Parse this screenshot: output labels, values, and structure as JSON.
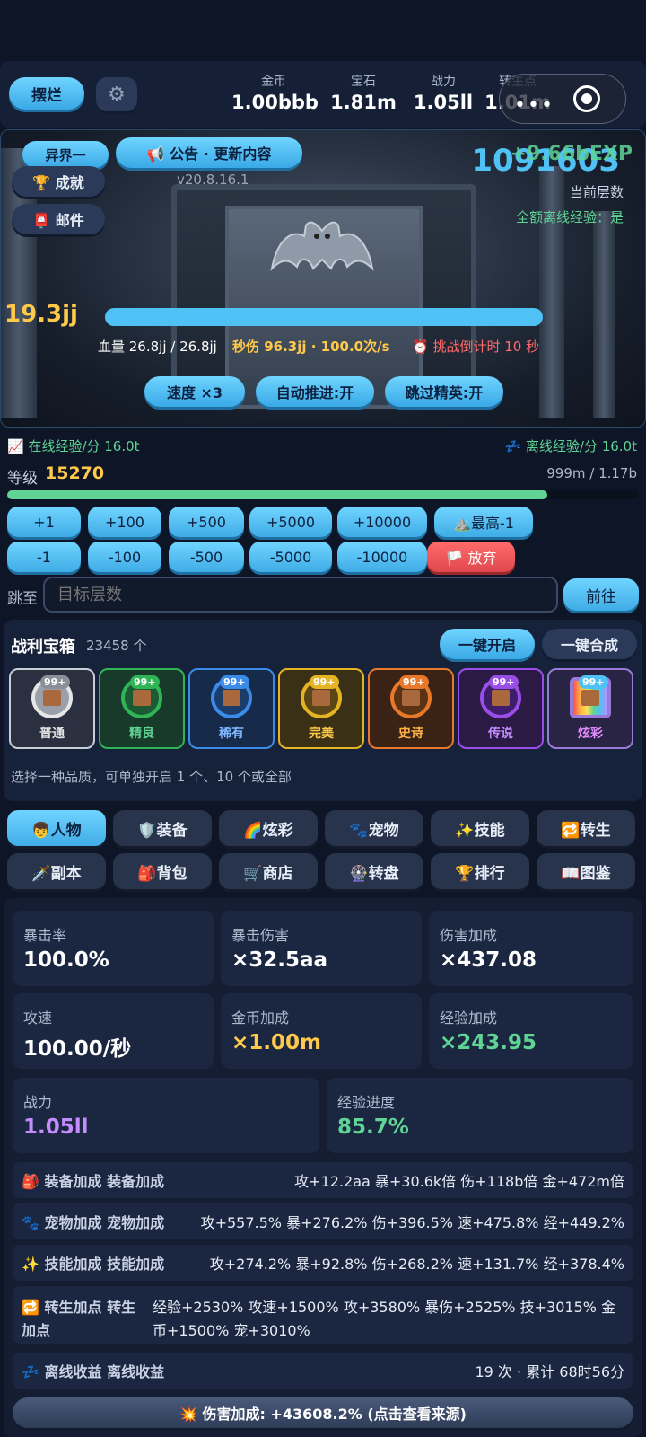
{
  "topbar": {
    "layout_btn": "摆烂",
    "settings_icon": "gear-icon",
    "stats": [
      {
        "label": "金币",
        "value": "1.00bbb"
      },
      {
        "label": "宝石",
        "value": "1.81m"
      },
      {
        "label": "战力",
        "value": "1.05ll"
      },
      {
        "label": "转生点",
        "value": "1.01m"
      }
    ]
  },
  "hero": {
    "world_btn": "异界一",
    "notice_btn": "📢 公告 · 更新内容",
    "achievement_btn": "🏆 成就",
    "mail_btn": "📮 邮件",
    "version": "v20.8.16.1",
    "floor_value": "1091603",
    "floor_overlay": "+9.66bEXP",
    "floor_label": "当前层数",
    "offline_full": "全额离线经验：是",
    "enemy_dmg": "19.3jj",
    "hp_text": "血量 26.8jj / 26.8jj",
    "dps_text": "秒伤 96.3jj · 100.0次/s",
    "countdown": "⏰ 挑战倒计时 10 秒",
    "hp_fraction": 1.0,
    "speed_btn": "速度 ×3",
    "auto_btn": "自动推进:开",
    "skip_btn": "跳过精英:开"
  },
  "exp": {
    "online": "📈 在线经验/分 16.0t",
    "offline": "💤 离线经验/分 16.0t",
    "level_label": "等级",
    "level": "15270",
    "progress_text": "999m / 1.17b",
    "progress_fraction": 0.855
  },
  "steps": {
    "plus": [
      "+1",
      "+100",
      "+500",
      "+5000",
      "+10000"
    ],
    "max": "⛰️最高-1",
    "minus": [
      "-1",
      "-100",
      "-500",
      "-5000",
      "-10000"
    ],
    "abandon": "🏳️ 放弃"
  },
  "jump": {
    "label": "跳至",
    "placeholder": "目标层数",
    "go": "前往"
  },
  "chests": {
    "title": "战利宝箱",
    "count": "23458 个",
    "open_all": "一键开启",
    "merge_all": "一键合成",
    "hint": "选择一种品质，可单独开启 1 个、10 个或全部",
    "badge": "99+",
    "items": [
      {
        "name": "普通"
      },
      {
        "name": "精良"
      },
      {
        "name": "稀有"
      },
      {
        "name": "完美"
      },
      {
        "name": "史诗"
      },
      {
        "name": "传说"
      },
      {
        "name": "炫彩"
      }
    ]
  },
  "tabs": [
    "👦人物",
    "🛡️装备",
    "🌈炫彩",
    "🐾宠物",
    "✨技能",
    "🔁转生",
    "🗡️副本",
    "🎒背包",
    "🛒商店",
    "🎡转盘",
    "🏆排行",
    "📖图鉴"
  ],
  "cards": [
    {
      "k": "暴击率",
      "v": "100.0%"
    },
    {
      "k": "暴击伤害",
      "v": "×32.5aa"
    },
    {
      "k": "伤害加成",
      "v": "×437.08"
    },
    {
      "k": "攻速",
      "v": "100.00/秒"
    },
    {
      "k": "金币加成",
      "v": "×1.00m"
    },
    {
      "k": "经验加成",
      "v": "×243.95"
    },
    {
      "k": "战力",
      "v": "1.05ll"
    },
    {
      "k": "经验进度",
      "v": "85.7%"
    }
  ],
  "rows": {
    "equip": {
      "title": "🎒 装备加成 装备加成",
      "value": "攻+12.2aa 暴+30.6k倍 伤+118b倍 金+472m倍"
    },
    "pet": {
      "title": "🐾 宠物加成 宠物加成",
      "value": "攻+557.5% 暴+276.2% 伤+396.5% 速+475.8% 经+449.2%"
    },
    "skill": {
      "title": "✨ 技能加成 技能加成",
      "value": "攻+274.2% 暴+92.8% 伤+268.2% 速+131.7% 经+378.4%"
    },
    "rebirth": {
      "title1": "🔁 转生加点 转生",
      "title2": "加点",
      "value1": "经验+2530% 攻速+1500% 攻+3580% 暴伤+2525% 技+3015% 金",
      "value2": "币+1500% 宠+3010%"
    },
    "offline": {
      "title": "💤 离线收益 离线收益",
      "value": "19 次 · 累计 68时56分"
    }
  },
  "footer": "💥 伤害加成: +43608.2% (点击查看来源)",
  "colors": {
    "accent": "#4fc1f4",
    "gold": "#ffc94a",
    "green": "#5fd495",
    "purple": "#c48cff",
    "orange": "#ffb347",
    "red": "#e0484e"
  }
}
